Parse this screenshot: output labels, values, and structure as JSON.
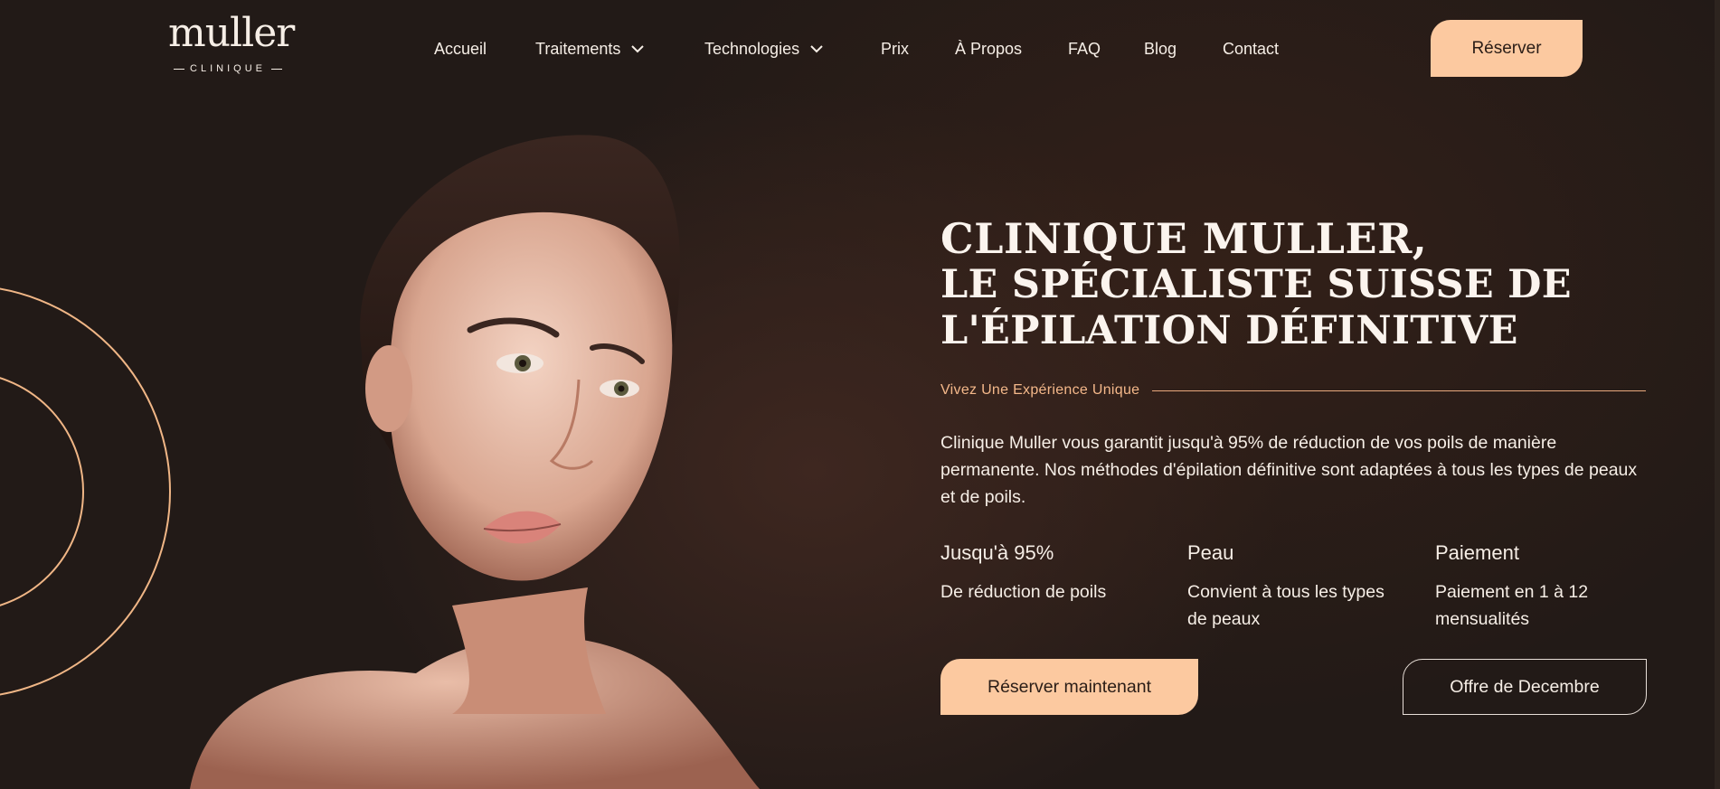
{
  "brand": {
    "logo_word": "muller",
    "logo_sub": "CLINIQUE"
  },
  "nav": {
    "items": [
      {
        "label": "Accueil"
      },
      {
        "label": "Traitements",
        "icon": "chevron-down-icon"
      },
      {
        "label": "Technologies",
        "icon": "chevron-down-icon"
      },
      {
        "label": "Prix"
      },
      {
        "label": "À Propos"
      },
      {
        "label": "FAQ"
      },
      {
        "label": "Blog"
      },
      {
        "label": "Contact"
      }
    ],
    "cta_label": "Réserver"
  },
  "hero": {
    "title_line1": "CLINIQUE MULLER,",
    "title_line2": "LE SPÉCIALISTE SUISSE DE",
    "title_line3": "L'ÉPILATION DÉFINITIVE",
    "tagline": "Vivez Une Expérience Unique",
    "description": "Clinique Muller vous garantit jusqu'à 95% de réduction de vos poils de manière permanente. Nos méthodes d'épilation définitive sont adaptées à tous les types de peaux et de poils.",
    "features": [
      {
        "title": "Jusqu'à 95%",
        "text": "De réduction de poils"
      },
      {
        "title": "Peau",
        "text": "Convient à tous les types de peaux"
      },
      {
        "title": "Paiement",
        "text": "Paiement en 1 à 12 mensualités"
      }
    ],
    "primary_button": "Réserver maintenant",
    "secondary_button": "Offre de Decembre"
  },
  "colors": {
    "background": "#221a17",
    "accent": "#fcc9a0",
    "tagline": "#f4b88a",
    "text": "#f6eee6"
  }
}
